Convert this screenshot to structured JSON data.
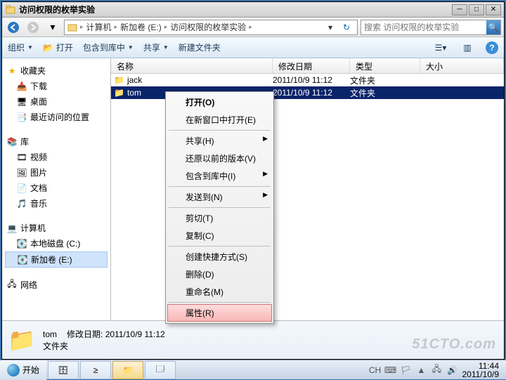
{
  "window": {
    "title": "访问权限的枚举实验"
  },
  "nav": {
    "crumbs": [
      "计算机",
      "新加卷 (E:)",
      "访问权限的枚举实验"
    ],
    "search_placeholder": "搜索 访问权限的枚举实验"
  },
  "toolbar": {
    "organize": "组织",
    "open": "打开",
    "include": "包含到库中",
    "share": "共享",
    "newfolder": "新建文件夹"
  },
  "sidebar": {
    "favorites": "收藏夹",
    "favorites_items": [
      "下载",
      "桌面",
      "最近访问的位置"
    ],
    "libraries": "库",
    "libraries_items": [
      "视频",
      "图片",
      "文档",
      "音乐"
    ],
    "computer": "计算机",
    "computer_items": [
      "本地磁盘 (C:)",
      "新加卷 (E:)"
    ],
    "network": "网络"
  },
  "columns": {
    "name": "名称",
    "modified": "修改日期",
    "type": "类型",
    "size": "大小"
  },
  "files": [
    {
      "name": "jack",
      "modified": "2011/10/9 11:12",
      "type": "文件夹",
      "selected": false
    },
    {
      "name": "tom",
      "modified": "2011/10/9 11:12",
      "type": "文件夹",
      "selected": true
    }
  ],
  "context_menu": {
    "open": "打开(O)",
    "open_new": "在新窗口中打开(E)",
    "share": "共享(H)",
    "restore": "还原以前的版本(V)",
    "include": "包含到库中(I)",
    "sendto": "发送到(N)",
    "cut": "剪切(T)",
    "copy": "复制(C)",
    "shortcut": "创建快捷方式(S)",
    "delete": "删除(D)",
    "rename": "重命名(M)",
    "properties": "属性(R)"
  },
  "detail": {
    "name": "tom",
    "modified_label": "修改日期:",
    "modified": "2011/10/9 11:12",
    "type": "文件夹"
  },
  "taskbar": {
    "start": "开始",
    "lang": "CH",
    "time": "11:44",
    "date": "2011/10/9"
  },
  "watermark": "51CTO.com"
}
